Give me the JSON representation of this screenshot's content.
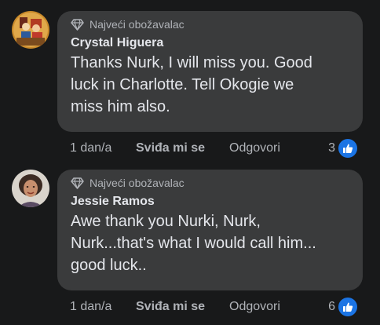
{
  "comments": [
    {
      "badge": "Najveći obožavalac",
      "author": "Crystal Higuera",
      "text": "Thanks Nurk, I will miss you. Good\nluck in Charlotte. Tell Okogie we\nmiss him also.",
      "time": "1 dan/a",
      "like_label": "Sviđa mi se",
      "reply_label": "Odgovori",
      "reaction_count": "3"
    },
    {
      "badge": "Najveći obožavalac",
      "author": "Jessie Ramos",
      "text": "Awe thank you Nurki, Nurk,\nNurk...that's what I would call him...\ngood luck..",
      "time": "1 dan/a",
      "like_label": "Sviđa mi se",
      "reply_label": "Odgovori",
      "reaction_count": "6"
    }
  ],
  "colors": {
    "background": "#18191a",
    "bubble": "#3a3b3c",
    "secondary_text": "#b0b3b8",
    "like_blue": "#1b74e4"
  }
}
